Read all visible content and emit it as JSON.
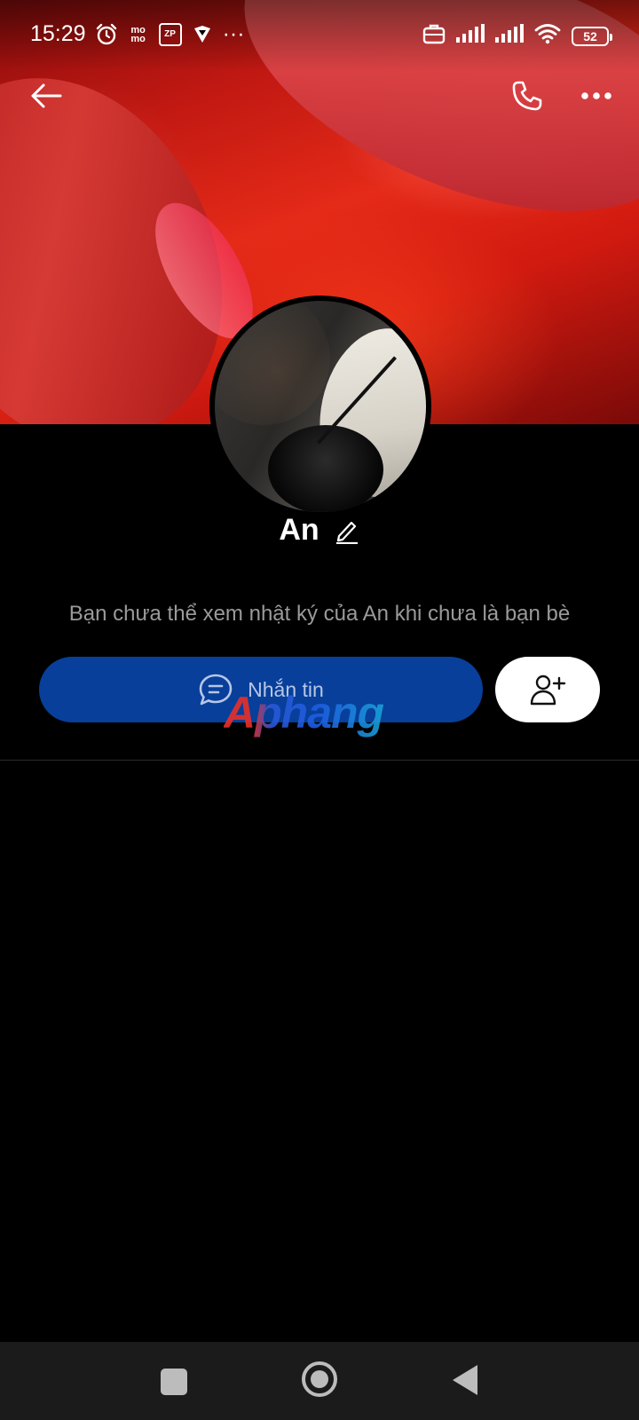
{
  "status_bar": {
    "time": "15:29",
    "momo_label": "mo\nmo",
    "zp_label": "ZP",
    "overflow": "···",
    "battery": "52"
  },
  "profile": {
    "name": "An",
    "info_text": "Bạn chưa thể xem nhật ký của An khi chưa là bạn bè"
  },
  "actions": {
    "message_label": "Nhắn tin"
  },
  "watermark": {
    "text": "Aphang"
  },
  "icons": {
    "back": "arrow-left-icon",
    "call": "phone-icon",
    "more": "more-horizontal-icon",
    "edit": "pencil-icon",
    "message": "chat-bubble-icon",
    "add_friend": "add-user-icon",
    "nav_recent": "square-icon",
    "nav_home": "circle-icon",
    "nav_back": "triangle-back-icon"
  },
  "colors": {
    "message_button": "#073f9a",
    "info_text": "#9a9a9a",
    "background": "#000000"
  }
}
